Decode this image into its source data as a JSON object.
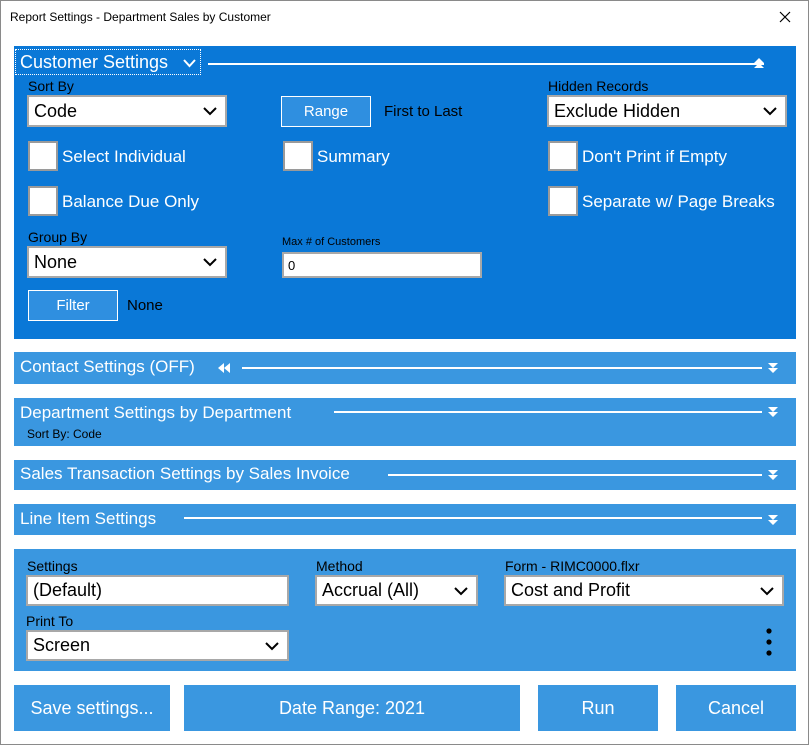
{
  "window": {
    "title": "Report Settings - Department Sales by Customer"
  },
  "customer_settings": {
    "title": "Customer Settings",
    "sort_by": {
      "label": "Sort By",
      "value": "Code"
    },
    "range": {
      "button_label": "Range",
      "value": "First to Last"
    },
    "hidden_records": {
      "label": "Hidden Records",
      "value": "Exclude Hidden"
    },
    "checkboxes": {
      "select_individual": "Select Individual",
      "summary": "Summary",
      "dont_print_if_empty": "Don't Print if Empty",
      "balance_due_only": "Balance Due Only",
      "separate_page_breaks": "Separate w/ Page Breaks"
    },
    "group_by": {
      "label": "Group By",
      "value": "None"
    },
    "max_customers": {
      "label": "Max # of Customers",
      "value": "0"
    },
    "filter": {
      "button_label": "Filter",
      "value": "None"
    }
  },
  "sections": {
    "contact": {
      "title": "Contact Settings (OFF)"
    },
    "department": {
      "title": "Department Settings by Department",
      "sub": "Sort By: Code"
    },
    "sales_transaction": {
      "title": "Sales Transaction Settings by Sales Invoice"
    },
    "line_item": {
      "title": "Line Item Settings"
    }
  },
  "output": {
    "settings": {
      "label": "Settings",
      "value": " (Default)"
    },
    "method": {
      "label": "Method",
      "value": "Accrual (All)"
    },
    "form": {
      "label": "Form - RIMC0000.flxr",
      "value": "Cost and Profit"
    },
    "print_to": {
      "label": "Print To",
      "value": "Screen"
    }
  },
  "actions": {
    "save": "Save settings...",
    "date_range": "Date Range: 2021",
    "run": "Run",
    "cancel": "Cancel"
  },
  "colors": {
    "panel_dark": "#0a78d7",
    "panel_light": "#3a97e0"
  }
}
